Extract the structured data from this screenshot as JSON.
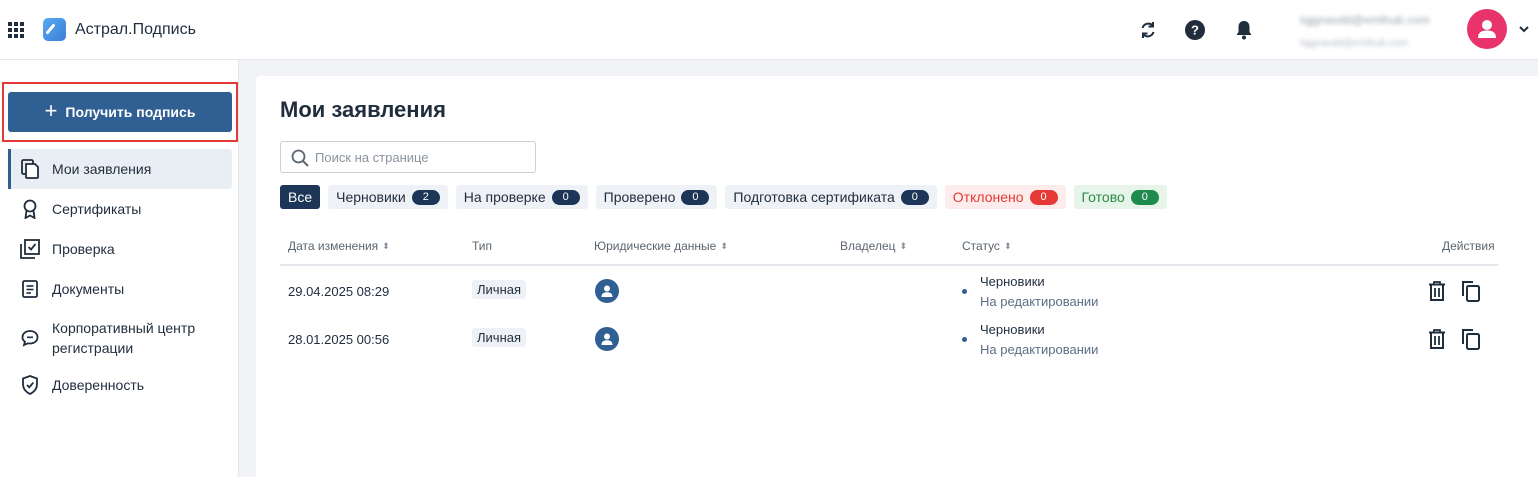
{
  "app": {
    "title": "Астрал.Подпись",
    "email": "tqjgnavdd@emlhub.com",
    "email_secondary": "tqjgnavdd@emlhub.com"
  },
  "sidebar": {
    "primary_button": "Получить подпись",
    "items": [
      {
        "label": "Мои заявления",
        "icon": "documents-copy-icon",
        "active": true
      },
      {
        "label": "Сертификаты",
        "icon": "award-icon"
      },
      {
        "label": "Проверка",
        "icon": "checkbox-stack-icon"
      },
      {
        "label": "Документы",
        "icon": "document-list-icon"
      },
      {
        "label": "Корпоративный центр регистрации",
        "label_line1": "Корпоративный центр",
        "label_line2": "регистрации",
        "icon": "chat-bubble-icon"
      },
      {
        "label": "Доверенность",
        "icon": "shield-icon"
      }
    ]
  },
  "main": {
    "title": "Мои заявления",
    "search_placeholder": "Поиск на странице",
    "filters": [
      {
        "label": "Все",
        "count": null,
        "selected": true
      },
      {
        "label": "Черновики",
        "count": "2"
      },
      {
        "label": "На проверке",
        "count": "0"
      },
      {
        "label": "Проверено",
        "count": "0"
      },
      {
        "label": "Подготовка сертификата",
        "count": "0"
      },
      {
        "label": "Отклонено",
        "count": "0",
        "color": "#e53935"
      },
      {
        "label": "Готово",
        "count": "0",
        "color": "#1e8a4c"
      }
    ],
    "columns": {
      "date": "Дата изменения",
      "type": "Тип",
      "legal": "Юридические данные",
      "owner": "Владелец",
      "status": "Статус",
      "actions": "Действия"
    },
    "rows": [
      {
        "date": "29.04.2025 08:29",
        "type": "Личная",
        "owner": "",
        "status": "Черновики",
        "substatus": "На редактировании"
      },
      {
        "date": "28.01.2025 00:56",
        "type": "Личная",
        "owner": "",
        "status": "Черновики",
        "substatus": "На редактировании"
      }
    ]
  },
  "colors": {
    "primary": "#2f5f93",
    "dark": "#1d3557",
    "avatar": "#e8336b",
    "highlight": "#e53935"
  }
}
